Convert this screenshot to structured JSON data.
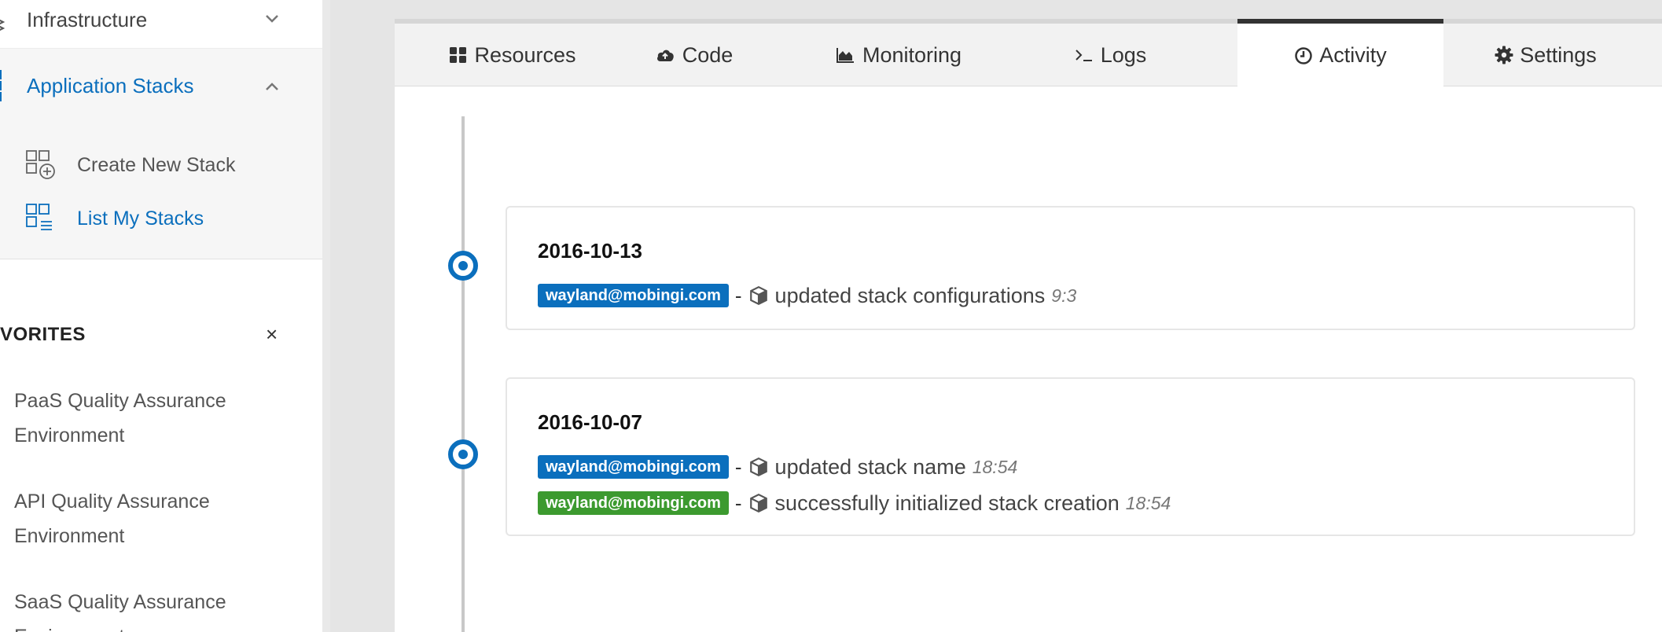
{
  "sidebar": {
    "infrastructure": "Infrastructure",
    "application_stacks": "Application Stacks",
    "submenu": [
      {
        "label": "Create New Stack"
      },
      {
        "label": "List My Stacks"
      }
    ],
    "favorites_title": "VORITES",
    "favorites_close": "×",
    "favorites": [
      {
        "line1": "PaaS Quality Assurance",
        "line2": "Environment"
      },
      {
        "line1": "API Quality Assurance",
        "line2": "Environment"
      },
      {
        "line1": "SaaS Quality Assurance",
        "line2": "Environment"
      }
    ]
  },
  "tabs": [
    {
      "label": "Resources",
      "icon": "grid-icon"
    },
    {
      "label": "Code",
      "icon": "cloud-upload-icon"
    },
    {
      "label": "Monitoring",
      "icon": "area-chart-icon"
    },
    {
      "label": "Logs",
      "icon": "terminal-icon"
    },
    {
      "label": "Activity",
      "icon": "clock-icon",
      "active": true
    },
    {
      "label": "Settings",
      "icon": "gear-icon"
    }
  ],
  "activity": [
    {
      "date": "2016-10-13",
      "entries": [
        {
          "user": "wayland@mobingi.com",
          "color": "blue",
          "message": "updated stack configurations",
          "time": "9:3"
        }
      ]
    },
    {
      "date": "2016-10-07",
      "entries": [
        {
          "user": "wayland@mobingi.com",
          "color": "blue",
          "message": "updated stack name",
          "time": "18:54"
        },
        {
          "user": "wayland@mobingi.com",
          "color": "green",
          "message": "successfully initialized stack creation",
          "time": "18:54"
        }
      ]
    }
  ],
  "colors": {
    "accent": "#0b6fbd",
    "success": "#3c9a2f"
  }
}
